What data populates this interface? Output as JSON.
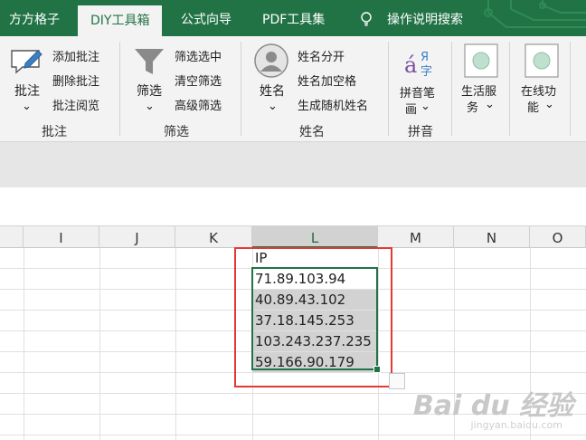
{
  "tabs": [
    {
      "label": "方方格子"
    },
    {
      "label": "DIY工具箱"
    },
    {
      "label": "公式向导"
    },
    {
      "label": "PDF工具集"
    },
    {
      "label": "操作说明搜索"
    }
  ],
  "ribbon": {
    "annotation": {
      "big": "批注",
      "add": "添加批注",
      "delete": "删除批注",
      "review": "批注阅览",
      "group": "批注"
    },
    "filter": {
      "big": "筛选",
      "select": "筛选选中",
      "clear": "清空筛选",
      "advanced": "高级筛选",
      "group": "筛选"
    },
    "name": {
      "big": "姓名",
      "split": "姓名分开",
      "space": "姓名加空格",
      "random": "生成随机姓名",
      "group": "姓名"
    },
    "pinyin": {
      "big_line1": "拼音笔",
      "big_line2": "画",
      "group": "拼音"
    },
    "life": {
      "line1": "生活服",
      "line2": "务"
    },
    "online": {
      "line1": "在线功",
      "line2": "能"
    }
  },
  "columns": [
    "I",
    "J",
    "K",
    "L",
    "M",
    "N",
    "O"
  ],
  "cells": {
    "header": "IP",
    "ips": [
      "71.89.103.94",
      "40.89.43.102",
      "37.18.145.253",
      "103.243.237.235",
      "59.166.90.179"
    ]
  },
  "watermark": {
    "main": "Bai du 经验",
    "sub": "jingyan.baidu.com"
  },
  "colors": {
    "excel_green": "#217346",
    "highlight_red": "#e53935",
    "selection_gray": "#d2d2d2"
  }
}
